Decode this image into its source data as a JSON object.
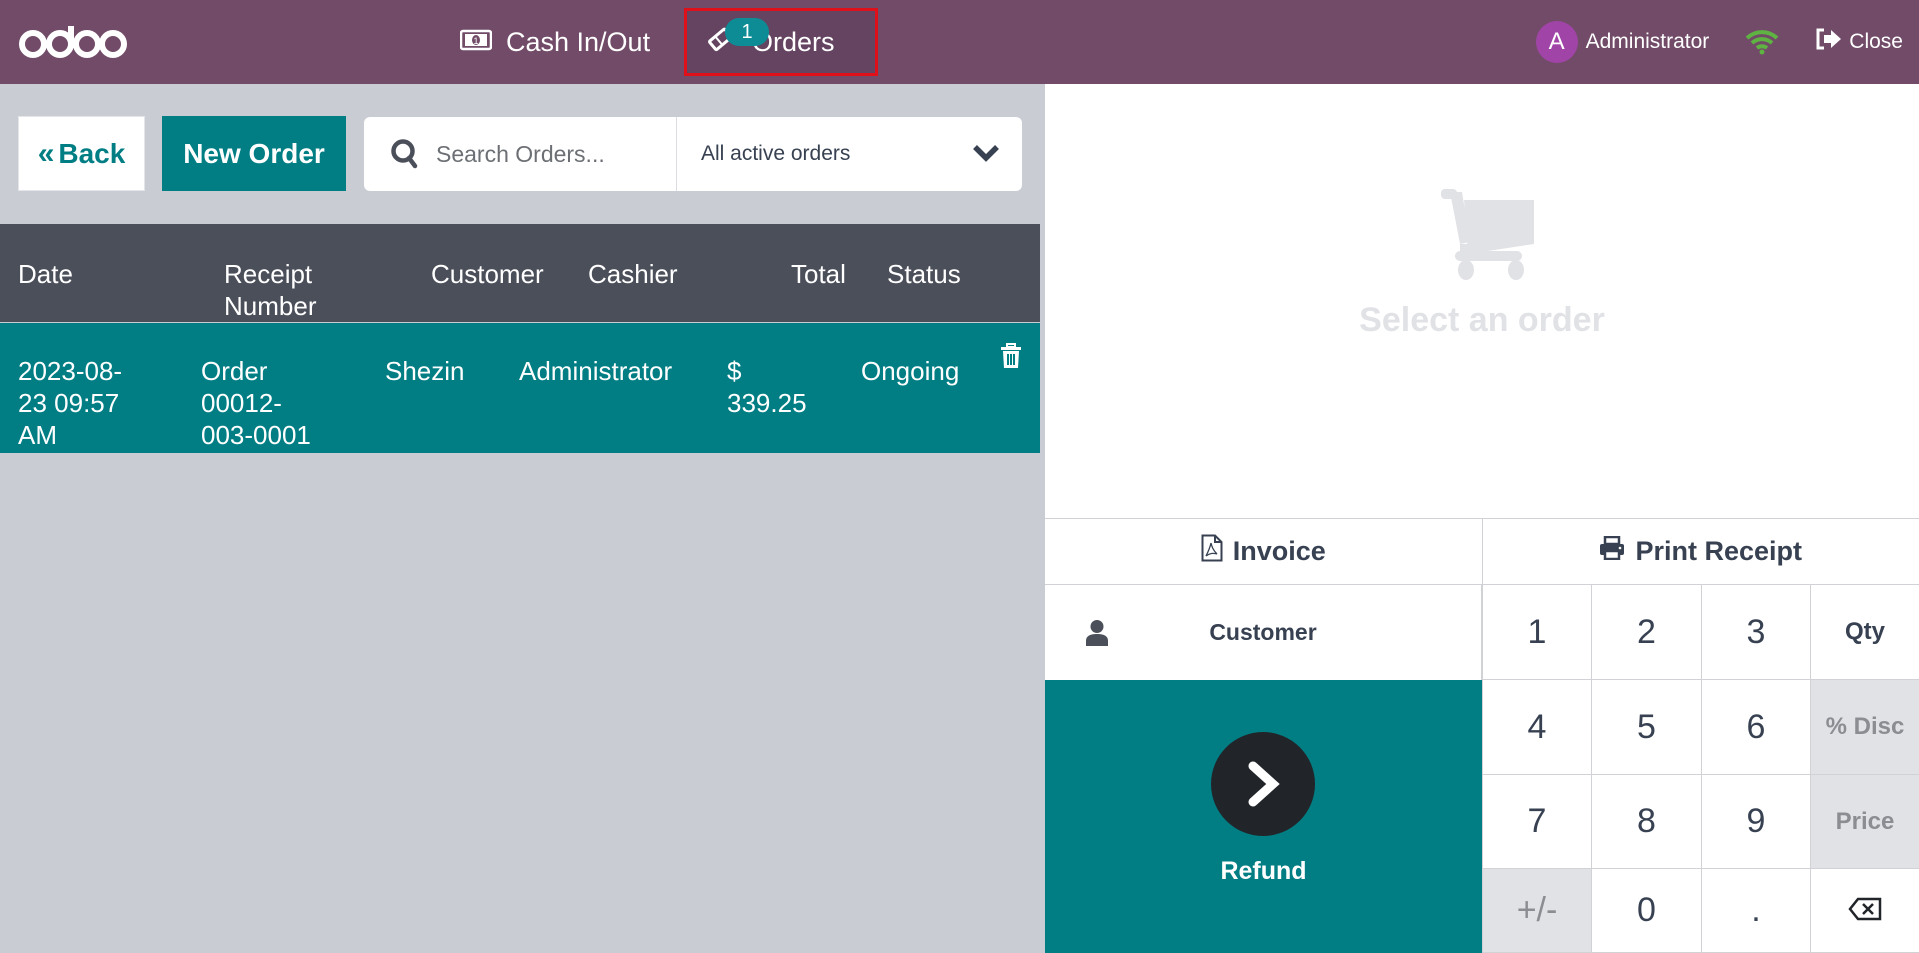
{
  "header": {
    "logo": "odoo",
    "nav": {
      "cash_in_out": "Cash In/Out",
      "orders": "Orders",
      "orders_badge": "1"
    },
    "user": {
      "avatar_initial": "A",
      "name": "Administrator"
    },
    "close": "Close",
    "icons": {
      "cash": "money-bill-icon",
      "orders": "ticket-icon",
      "wifi": "wifi-icon",
      "close": "sign-out-icon"
    },
    "colors": {
      "bar": "#714b67",
      "wifi": "#5fb343",
      "highlight": "#e0101a"
    }
  },
  "toolbar": {
    "back_label": "Back",
    "new_order_label": "New Order",
    "search_placeholder": "Search Orders...",
    "search_value": "",
    "filter_selected": "All active orders"
  },
  "table": {
    "columns": [
      "Date",
      "Receipt Number",
      "Customer",
      "Cashier",
      "Total",
      "Status"
    ],
    "rows": [
      {
        "date_line1": "2023-08-",
        "date_line2": "23 09:57",
        "date_line3": "AM",
        "receipt_line1": "Order",
        "receipt_line2": "00012-",
        "receipt_line3": "003-0001",
        "customer": "Shezin",
        "cashier": "Administrator",
        "total_line1": "$",
        "total_line2": "339.25",
        "status": "Ongoing"
      }
    ]
  },
  "detail": {
    "empty_text": "Select an order",
    "invoice_label": "Invoice",
    "print_label": "Print Receipt",
    "customer_label": "Customer",
    "refund_label": "Refund"
  },
  "numpad": {
    "keys": [
      "1",
      "2",
      "3",
      "Qty",
      "4",
      "5",
      "6",
      "% Disc",
      "7",
      "8",
      "9",
      "Price",
      "+/-",
      "0",
      ".",
      "backspace"
    ]
  },
  "theme": {
    "primary": "#017e84",
    "table_header": "#4b4f5a",
    "background": "#c9ccd3"
  }
}
